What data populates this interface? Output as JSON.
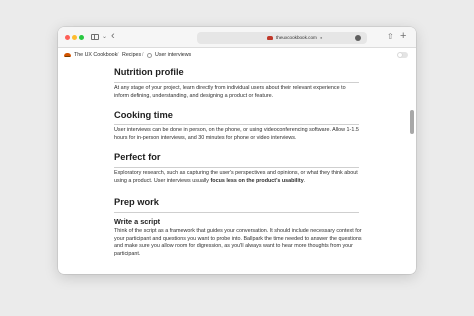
{
  "browser": {
    "url": "theuxcookbook.com",
    "icons": {
      "traffic_lights": [
        "close-dot",
        "minimize-dot",
        "zoom-dot"
      ],
      "sidebar": "sidebar-toggle-icon",
      "back": "back-arrow-icon",
      "share": "share-icon",
      "new_tab": "new-tab-icon"
    },
    "colors": {
      "red": "#fe5f57",
      "yellow": "#febc2e",
      "green": "#28c840"
    }
  },
  "breadcrumb": {
    "home": "The UX Cookbook",
    "separator": "/",
    "section": "Recipes",
    "current": "User interviews"
  },
  "sections": {
    "nutrition": {
      "heading": "Nutrition profile",
      "body": "At any stage of your project, learn directly from individual users about their relevant experience to inform defining, understanding, and designing a product or feature."
    },
    "cooking": {
      "heading": "Cooking time",
      "body": "User interviews can be done in person, on the phone, or using videoconferencing software. Allow 1-1.5 hours for in-person interviews, and 30 minutes for phone or video interviews."
    },
    "perfect": {
      "heading": "Perfect for",
      "body_start": "Exploratory research, such as capturing the user's perspectives and opinions, or what they think about using a product. User interviews usually ",
      "body_bold": "focus less on the product's usability",
      "body_end": "."
    },
    "prep": {
      "heading": "Prep work",
      "subheading": "Write a script",
      "body": "Think of the script as a framework that guides your conversation. It should include necessary context for your participant and questions you want to probe into. Ballpark the time needed to answer the questions and make sure you allow room for digression, as you'll always want to hear more thoughts from your participant."
    }
  }
}
